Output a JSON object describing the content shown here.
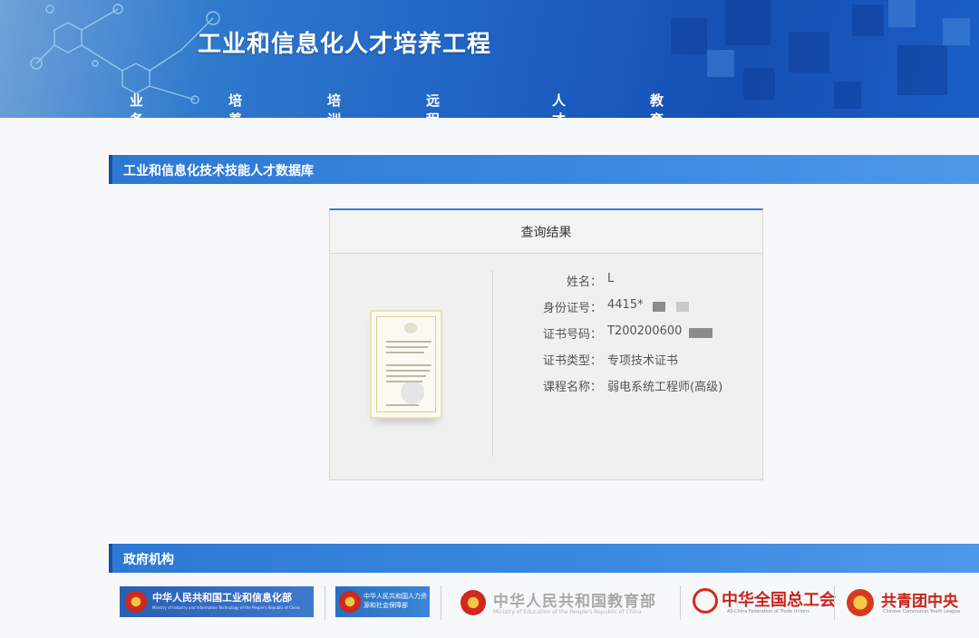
{
  "header": {
    "site_title": "工业和信息化人才培养工程",
    "nav": [
      "业务介绍",
      "培养标准",
      "培训管理",
      "远程学历教育",
      "人才研究",
      "教育培训动态"
    ]
  },
  "database_section": {
    "title": "工业和信息化技术技能人才数据库"
  },
  "result_card": {
    "title": "查询结果",
    "fields": [
      {
        "label": "姓名：",
        "value": "L"
      },
      {
        "label": "身份证号：",
        "value": "4415*"
      },
      {
        "label": "证书号码：",
        "value": "T200200600"
      },
      {
        "label": "证书类型：",
        "value": "专项技术证书"
      },
      {
        "label": "课程名称：",
        "value": "弱电系统工程师(高级)"
      }
    ]
  },
  "gov_section": {
    "title": "政府机构",
    "logos": [
      {
        "name": "中华人民共和国工业和信息化部",
        "sub": "Ministry of Industry and Information Technology of the People's Republic of China"
      },
      {
        "name": "中华人民共和国人力资源和社会保障部"
      },
      {
        "name": "中华人民共和国教育部",
        "sub": "Ministry of Education of the People's Republic of China"
      },
      {
        "name": "中华全国总工会",
        "sub": "All-China Federation of Trade Unions"
      },
      {
        "name": "共青团中央",
        "sub": "Chinese Communist Youth League"
      }
    ]
  },
  "colors": {
    "header_blue": "#1f62c4",
    "section_bar": "#3c8ae0",
    "card_top": "#3d7fc8",
    "emblem_red": "#d32b1f"
  }
}
